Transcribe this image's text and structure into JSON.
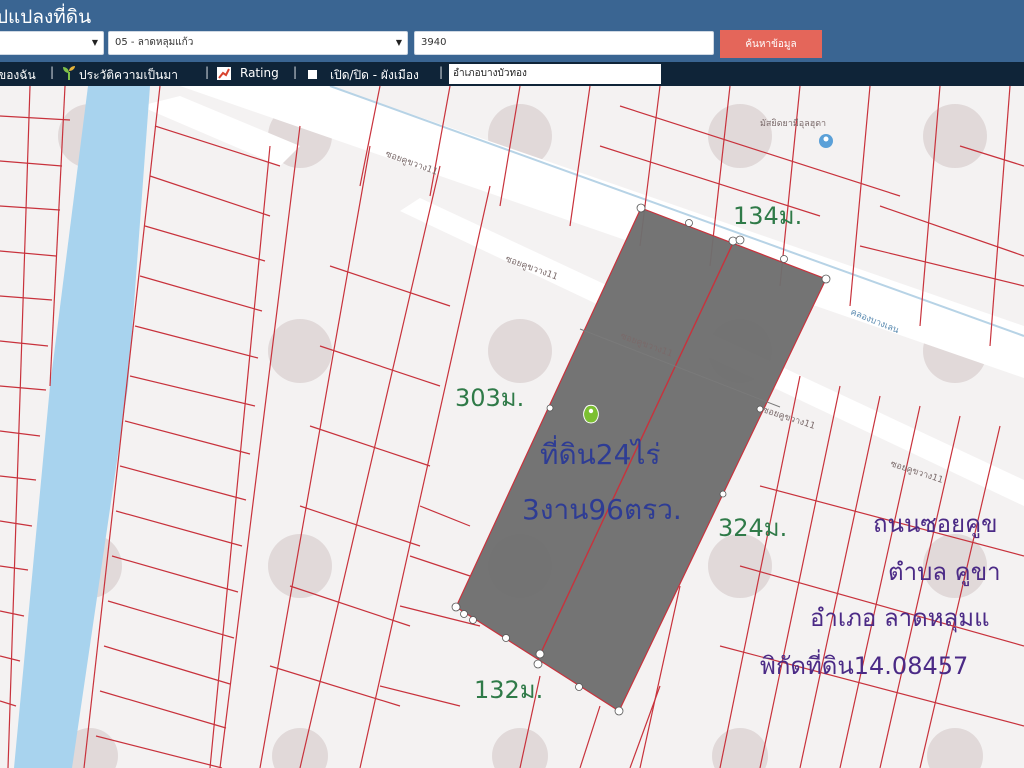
{
  "header": {
    "title": "ปแปลงที่ดิน",
    "province_value": "",
    "district_value": "05 - ลาดหลุมแก้ว",
    "parcel_number_value": "3940",
    "search_label": "ค้นหาข้อมูล"
  },
  "toolbar": {
    "item_my_label": "ของฉัน",
    "history_label": "ประวัติความเป็นมา",
    "rating_label": "Rating",
    "toggle_label": "เปิด/ปิด - ผังเมือง",
    "district_filter_value": "อำเภอบางบัวทอง",
    "separator": "|"
  },
  "map": {
    "street_labels": [
      "ซอยคูขวาง11",
      "ซอยคูขวาง11",
      "ซอยคูขวาง11",
      "ซอยคูขวาง11",
      "ซอยคูขวาง11",
      "คลองบางเลน",
      "มัสยิดยามีอุลฮุดา"
    ],
    "dimensions": {
      "top": "134ม.",
      "left": "303ม.",
      "right": "324ม.",
      "bottom": "132ม."
    },
    "area_line1": "ที่ดิน24ไร่",
    "area_line2": "3งาน96ตรว.",
    "address": {
      "line1": "ถนนซอยคูข",
      "line2": "ตำบล คูขา",
      "line3": "อำเภอ ลาดหลุมแ",
      "line4": "พิกัดที่ดิน14.08457"
    },
    "colors": {
      "parcel_line": "#c8323c",
      "selected_fill": "#6e6e6e",
      "canal": "#a8d3ee",
      "dimension_text": "#2f7a48",
      "area_text": "#2e3c94",
      "address_text": "#4b2a86",
      "pin": "#7cbf32"
    }
  }
}
